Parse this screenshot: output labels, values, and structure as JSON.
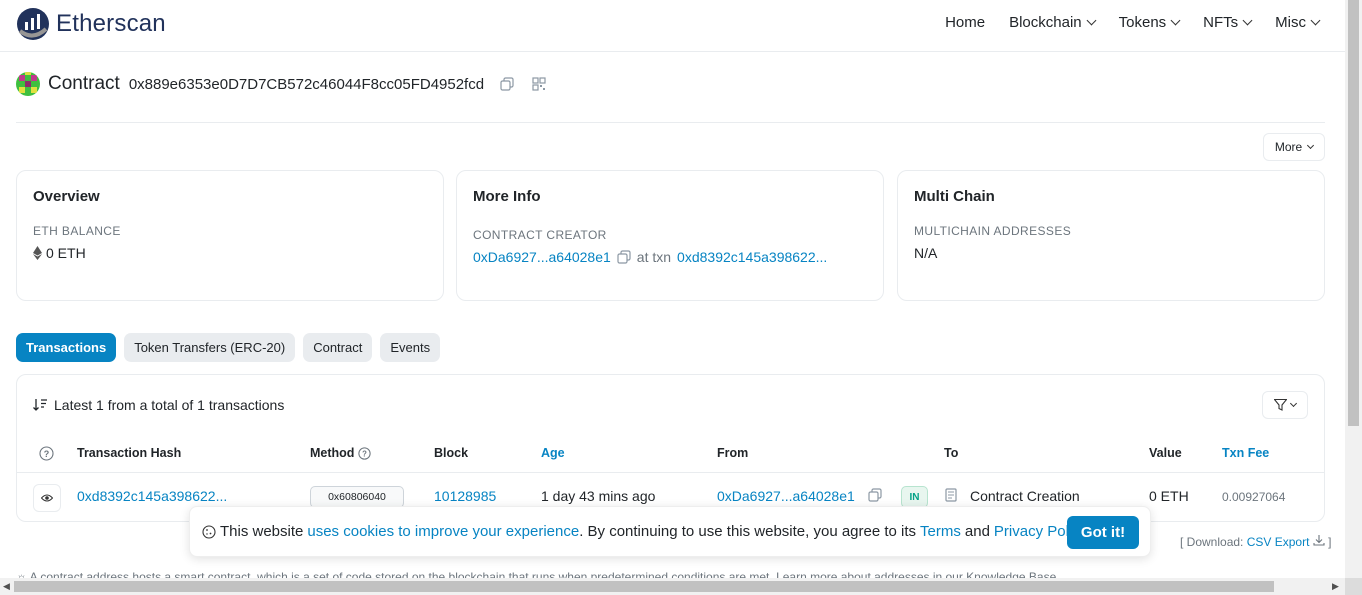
{
  "header": {
    "logo_text": "Etherscan",
    "nav": [
      "Home",
      "Blockchain",
      "Tokens",
      "NFTs",
      "Misc"
    ]
  },
  "contract": {
    "label": "Contract",
    "address": "0x889e6353e0D7D7CB572c46044F8cc05FD4952fcd"
  },
  "more_button": "More",
  "overview": {
    "title": "Overview",
    "caption": "ETH BALANCE",
    "value": "0 ETH"
  },
  "more_info": {
    "title": "More Info",
    "caption": "CONTRACT CREATOR",
    "creator": "0xDa6927...a64028e1",
    "at_txn": "at txn",
    "txn": "0xd8392c145a398622..."
  },
  "multi_chain": {
    "title": "Multi Chain",
    "caption": "MULTICHAIN ADDRESSES",
    "value": "N/A"
  },
  "tabs": [
    "Transactions",
    "Token Transfers (ERC-20)",
    "Contract",
    "Events"
  ],
  "table": {
    "summary": "Latest 1 from a total of 1 transactions",
    "headers": [
      "Transaction Hash",
      "Method",
      "Block",
      "Age",
      "From",
      "To",
      "Value",
      "Txn Fee"
    ],
    "rows": [
      {
        "hash": "0xd8392c145a398622...",
        "method": "0x60806040",
        "block": "10128985",
        "age": "1 day 43 mins ago",
        "from": "0xDa6927...a64028e1",
        "direction": "IN",
        "to": "Contract Creation",
        "value": "0 ETH",
        "fee": "0.00927064"
      }
    ]
  },
  "cookie": {
    "text1": "This website",
    "link1": "uses cookies to improve your experience",
    "text2": ". By continuing to use this website, you agree to its",
    "terms": "Terms",
    "and": "and",
    "privacy": "Privacy Policy",
    "period": ".",
    "button": "Got it!"
  },
  "download": {
    "prefix": "[ Download:",
    "link": "CSV Export",
    "suffix": "]"
  },
  "footnote": "A contract address hosts a smart contract, which is a set of code stored on the blockchain that runs when predetermined conditions are met. Learn more about addresses in our Knowledge Base.",
  "colors": {
    "accent": "#0784c3",
    "brand_navy": "#21325b",
    "in_badge": "#00a186"
  }
}
